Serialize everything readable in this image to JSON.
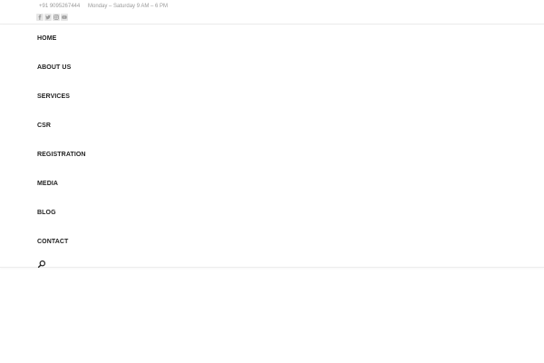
{
  "topbar": {
    "phone": "+91 9095267444",
    "hours": "Monday – Saturday 9 AM – 6 PM",
    "socials": [
      {
        "icon": "facebook-icon",
        "glyph": "f"
      },
      {
        "icon": "twitter-icon",
        "glyph": "t"
      },
      {
        "icon": "instagram-icon",
        "glyph": "ig"
      },
      {
        "icon": "youtube-icon",
        "glyph": "yt"
      }
    ]
  },
  "nav": {
    "items": [
      {
        "label": "HOME"
      },
      {
        "label": "ABOUT US"
      },
      {
        "label": "SERVICES"
      },
      {
        "label": "CSR"
      },
      {
        "label": "REGISTRATION"
      },
      {
        "label": "MEDIA"
      },
      {
        "label": "BLOG"
      },
      {
        "label": "CONTACT"
      }
    ],
    "search_icon": "search-icon"
  },
  "colors": {
    "nav_text": "#222222",
    "topbar_text": "#9a9a9a",
    "social_bg": "#e6e6e6",
    "divider": "#ececec"
  }
}
